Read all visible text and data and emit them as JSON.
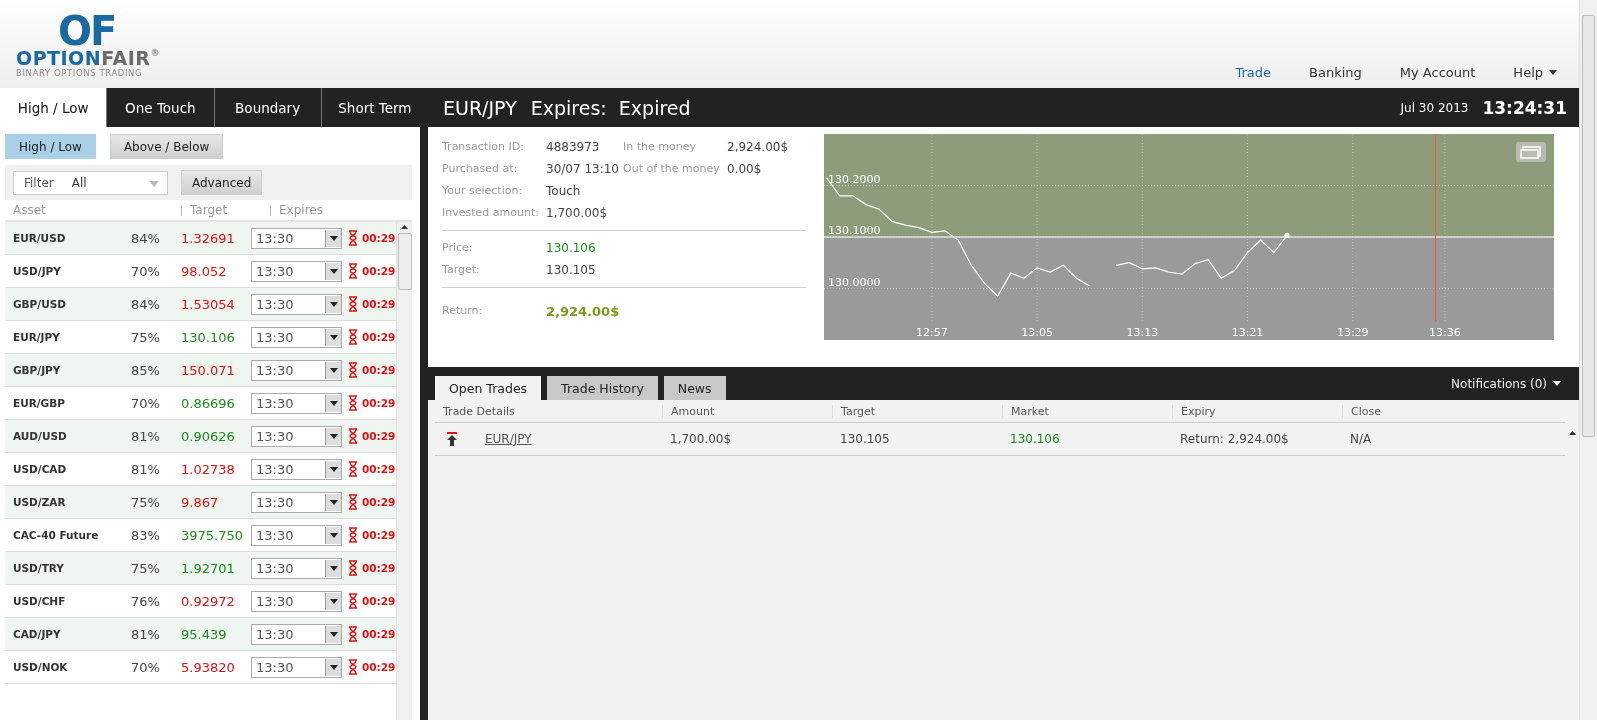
{
  "logo": {
    "mark": "OF",
    "name_part_1": "OPTION",
    "name_part_2": "FAIR",
    "registered": "®",
    "tagline": "BINARY OPTIONS TRADING"
  },
  "nav": [
    {
      "label": "Trade",
      "selected": true,
      "has_menu": false
    },
    {
      "label": "Banking",
      "selected": false,
      "has_menu": false
    },
    {
      "label": "My Account",
      "selected": false,
      "has_menu": false
    },
    {
      "label": "Help",
      "selected": false,
      "has_menu": true
    }
  ],
  "option_tabs": [
    {
      "label": "High / Low",
      "selected": true
    },
    {
      "label": "One Touch",
      "selected": false
    },
    {
      "label": "Boundary",
      "selected": false
    },
    {
      "label": "Short Term",
      "selected": false
    }
  ],
  "sub_tabs": [
    {
      "label": "High / Low",
      "selected": true
    },
    {
      "label": "Above / Below",
      "selected": false
    }
  ],
  "filter": {
    "label": "Filter",
    "value": "All",
    "advanced_button": "Advanced"
  },
  "asset_columns": [
    "Asset",
    "Target",
    "Expires"
  ],
  "assets": [
    {
      "asset": "EUR/USD",
      "payout": "84%",
      "target": "1.32691",
      "color": "#e01010",
      "expiry": "13:30",
      "countdown": "00:29"
    },
    {
      "asset": "USD/JPY",
      "payout": "70%",
      "target": "98.052",
      "color": "#e01010",
      "expiry": "13:30",
      "countdown": "00:29"
    },
    {
      "asset": "GBP/USD",
      "payout": "84%",
      "target": "1.53054",
      "color": "#e01010",
      "expiry": "13:30",
      "countdown": "00:29"
    },
    {
      "asset": "EUR/JPY",
      "payout": "75%",
      "target": "130.106",
      "color": "#1e8a1e",
      "expiry": "13:30",
      "countdown": "00:29"
    },
    {
      "asset": "GBP/JPY",
      "payout": "85%",
      "target": "150.071",
      "color": "#e01010",
      "expiry": "13:30",
      "countdown": "00:29"
    },
    {
      "asset": "EUR/GBP",
      "payout": "70%",
      "target": "0.86696",
      "color": "#1e8a1e",
      "expiry": "13:30",
      "countdown": "00:29"
    },
    {
      "asset": "AUD/USD",
      "payout": "81%",
      "target": "0.90626",
      "color": "#1e8a1e",
      "expiry": "13:30",
      "countdown": "00:29"
    },
    {
      "asset": "USD/CAD",
      "payout": "81%",
      "target": "1.02738",
      "color": "#e01010",
      "expiry": "13:30",
      "countdown": "00:29"
    },
    {
      "asset": "USD/ZAR",
      "payout": "75%",
      "target": "9.867",
      "color": "#e01010",
      "expiry": "13:30",
      "countdown": "00:29"
    },
    {
      "asset": "CAC-40 Future",
      "payout": "83%",
      "target": "3975.750",
      "color": "#1e8a1e",
      "expiry": "13:30",
      "countdown": "00:29"
    },
    {
      "asset": "USD/TRY",
      "payout": "75%",
      "target": "1.92701",
      "color": "#1e8a1e",
      "expiry": "13:30",
      "countdown": "00:29"
    },
    {
      "asset": "USD/CHF",
      "payout": "76%",
      "target": "0.92972",
      "color": "#e01010",
      "expiry": "13:30",
      "countdown": "00:29"
    },
    {
      "asset": "CAD/JPY",
      "payout": "81%",
      "target": "95.439",
      "color": "#1e8a1e",
      "expiry": "13:30",
      "countdown": "00:29"
    },
    {
      "asset": "USD/NOK",
      "payout": "70%",
      "target": "5.93820",
      "color": "#e01010",
      "expiry": "13:30",
      "countdown": "00:29"
    }
  ],
  "trade_header": {
    "asset": "EUR/JPY",
    "expires": "Expires:  Expired",
    "date": "Jul 30 2013",
    "time": "13:24:31"
  },
  "details_left": [
    {
      "label": "Transaction ID:",
      "value": "4883973"
    },
    {
      "label": "Purchased at:",
      "value": "30/07 13:10"
    },
    {
      "label": "Your selection:",
      "value": "Touch"
    },
    {
      "label": "Invested amount:",
      "value": "1,700.00$"
    }
  ],
  "details_right": [
    {
      "label": "In the money",
      "value": "2,924.00$"
    },
    {
      "label": "Out of the money",
      "value": "0.00$"
    }
  ],
  "price_rows": [
    {
      "label": "Price:",
      "value": "130.106",
      "color": "#1e8a1e"
    },
    {
      "label": "Target:",
      "value": "130.105",
      "color": "#444444"
    }
  ],
  "return_row": {
    "label": "Return:",
    "value": "2,924.00$",
    "color": "#7a9a1e"
  },
  "chart": {
    "chart_data": {
      "type": "line",
      "categories": [
        null,
        null,
        null,
        null,
        null,
        null,
        null,
        null,
        "12:57",
        null,
        null,
        null,
        null,
        null,
        null,
        null,
        "13:05",
        null,
        null,
        null,
        null,
        null,
        null,
        null,
        "13:13",
        null,
        null,
        null,
        null,
        null,
        null,
        null,
        "13:21",
        null,
        null,
        null,
        null,
        null,
        null,
        null,
        "13:29",
        null,
        null,
        null,
        null,
        null,
        null,
        "13:36",
        null,
        null,
        null,
        null,
        null,
        null,
        null,
        null
      ],
      "series": [
        {
          "color": "#ffffff",
          "values": [
            130.215,
            130.18,
            130.18,
            130.163,
            130.154,
            130.13,
            130.123,
            130.118,
            130.109,
            130.112,
            130.094,
            130.045,
            130.01,
            129.985,
            130.03,
            130.02,
            130.04,
            130.032,
            130.045,
            130.02,
            130.005,
            null,
            130.045,
            130.05,
            130.038,
            130.04,
            130.032,
            130.028,
            130.048,
            130.056,
            130.02,
            130.035,
            130.07,
            130.094,
            130.07,
            130.103,
            null,
            null,
            null,
            null,
            null,
            null,
            null,
            null,
            null,
            null,
            null,
            null,
            null,
            null,
            null,
            null,
            null,
            null,
            null,
            null
          ]
        }
      ],
      "ylim": [
        129.9,
        130.3
      ],
      "grid": true,
      "yticks": [
        {
          "value": 130.0,
          "label": "130.0000"
        },
        {
          "value": 130.1,
          "label": "130.1000"
        },
        {
          "value": 130.2,
          "label": "130.2000"
        }
      ],
      "ref_lines": [
        {
          "axis": "y",
          "value": 130.1
        }
      ]
    }
  },
  "bottom_tabs": [
    {
      "label": "Open Trades",
      "selected": true
    },
    {
      "label": "Trade History",
      "selected": false
    },
    {
      "label": "News",
      "selected": false
    }
  ],
  "notifications": "Notifications (0)",
  "trade_columns": [
    "Trade Details",
    "Amount",
    "Target",
    "Market",
    "Expiry",
    "Close"
  ],
  "open_trades": [
    {
      "asset": "EUR/JPY",
      "amount": "1,700.00$",
      "target": "130.105",
      "market": "130.106",
      "expiry": "Return: 2,924.00$",
      "close": "N/A"
    }
  ]
}
